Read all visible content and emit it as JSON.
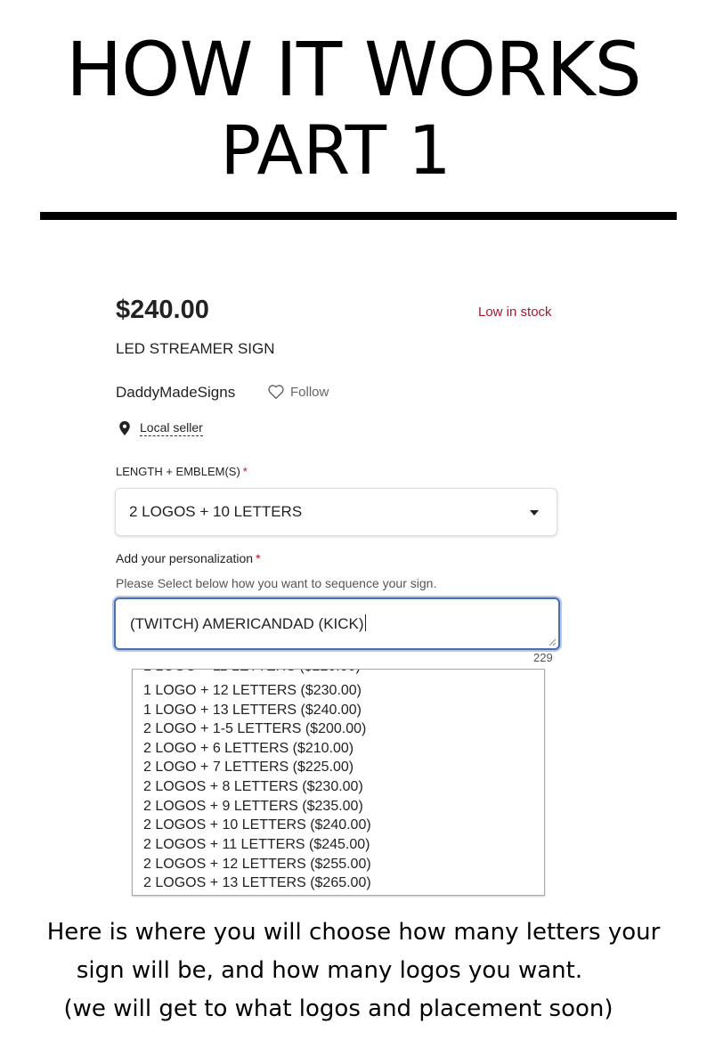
{
  "page": {
    "title_line1": "HOW IT WORKS",
    "title_line2": "PART 1"
  },
  "listing": {
    "price": "$240.00",
    "stock_status": "Low in stock",
    "product_name": "LED STREAMER SIGN",
    "seller_name": "DaddyMadeSigns",
    "follow_label": "Follow",
    "local_seller_label": "Local seller",
    "colors": {
      "accent": "#a61a2e",
      "focus": "#4a6fb0"
    }
  },
  "variation": {
    "label": "LENGTH + EMBLEM(S)",
    "required_mark": "*",
    "selected_value": "2 LOGOS + 10 LETTERS"
  },
  "personalization": {
    "label": "Add your personalization",
    "required_mark": "*",
    "help_text": "Please Select below how you want to sequence your sign.",
    "value": "(TWITCH) AMERICANDAD (KICK)",
    "char_count": "229"
  },
  "dropdown": {
    "options": [
      "1 LOGO + 12 LETTERS ($230.00)",
      "1 LOGO + 13 LETTERS ($240.00)",
      "2 LOGO + 1-5 LETTERS ($200.00)",
      "2 LOGO + 6 LETTERS ($210.00)",
      "2 LOGO + 7 LETTERS ($225.00)",
      "2 LOGOS + 8 LETTERS ($230.00)",
      "2 LOGOS + 9 LETTERS ($235.00)",
      "2 LOGOS + 10 LETTERS ($240.00)",
      "2 LOGOS + 11 LETTERS ($245.00)",
      "2 LOGOS + 12 LETTERS ($255.00)",
      "2 LOGOS + 13 LETTERS ($265.00)"
    ]
  },
  "caption": {
    "line1": "Here is where you will choose how many letters your",
    "line2": "sign will be, and how many logos you want.",
    "line3": "(we will get to what logos and placement soon)"
  }
}
